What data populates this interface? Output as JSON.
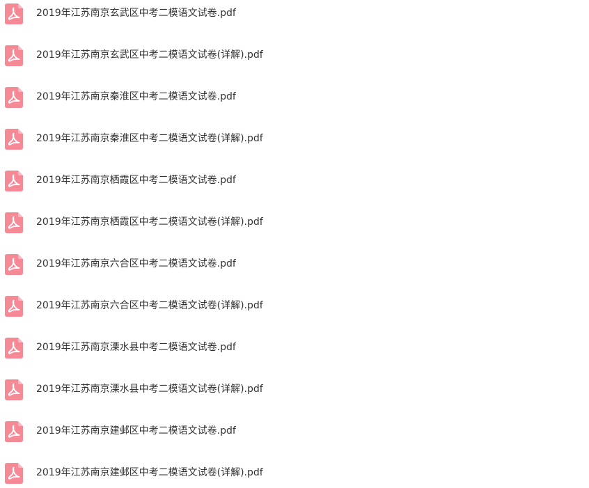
{
  "files": [
    {
      "name": "2019年江苏南京玄武区中考二模语文试卷.pdf",
      "icon": "pdf-file-icon"
    },
    {
      "name": "2019年江苏南京玄武区中考二模语文试卷(详解).pdf",
      "icon": "pdf-file-icon"
    },
    {
      "name": "2019年江苏南京秦淮区中考二模语文试卷.pdf",
      "icon": "pdf-file-icon"
    },
    {
      "name": "2019年江苏南京秦淮区中考二模语文试卷(详解).pdf",
      "icon": "pdf-file-icon"
    },
    {
      "name": "2019年江苏南京栖霞区中考二模语文试卷.pdf",
      "icon": "pdf-file-icon"
    },
    {
      "name": "2019年江苏南京栖霞区中考二模语文试卷(详解).pdf",
      "icon": "pdf-file-icon"
    },
    {
      "name": "2019年江苏南京六合区中考二模语文试卷.pdf",
      "icon": "pdf-file-icon"
    },
    {
      "name": "2019年江苏南京六合区中考二模语文试卷(详解).pdf",
      "icon": "pdf-file-icon"
    },
    {
      "name": "2019年江苏南京溧水县中考二模语文试卷.pdf",
      "icon": "pdf-file-icon"
    },
    {
      "name": "2019年江苏南京溧水县中考二模语文试卷(详解).pdf",
      "icon": "pdf-file-icon"
    },
    {
      "name": "2019年江苏南京建邺区中考二模语文试卷.pdf",
      "icon": "pdf-file-icon"
    },
    {
      "name": "2019年江苏南京建邺区中考二模语文试卷(详解).pdf",
      "icon": "pdf-file-icon"
    }
  ],
  "colors": {
    "icon_fill": "#f58a96",
    "icon_fold": "#f9b8c0",
    "icon_glyph": "#ffffff",
    "text": "#333333",
    "background": "#ffffff"
  }
}
